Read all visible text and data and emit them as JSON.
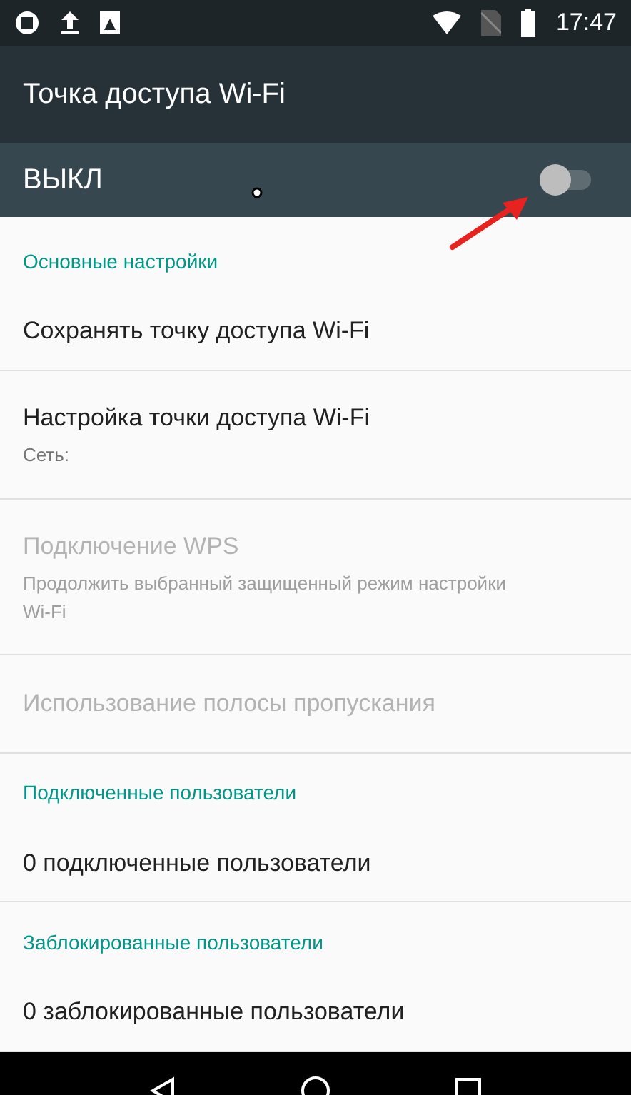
{
  "status_bar": {
    "time": "17:47"
  },
  "app_bar": {
    "title": "Точка доступа Wi-Fi"
  },
  "master_switch": {
    "label": "ВЫКЛ",
    "on": false
  },
  "list": [
    {
      "kind": "header",
      "title": "Основные настройки"
    },
    {
      "kind": "item",
      "title": "Сохранять точку доступа Wi-Fi",
      "disabled": false
    },
    {
      "kind": "item",
      "title": "Настройка точки доступа Wi-Fi",
      "subtitle": "Сеть:",
      "disabled": false
    },
    {
      "kind": "item",
      "title": "Подключение WPS",
      "subtitle": "Продолжить выбранный защищенный режим настройки Wi-Fi",
      "disabled": true
    },
    {
      "kind": "item",
      "title": "Использование полосы пропускания",
      "disabled": true
    },
    {
      "kind": "header",
      "title": "Подключенные пользователи"
    },
    {
      "kind": "item",
      "title": "0 подключенные пользователи",
      "disabled": false
    },
    {
      "kind": "header",
      "title": "Заблокированные пользователи"
    },
    {
      "kind": "item",
      "title": "0 заблокированные пользователи",
      "disabled": false
    }
  ]
}
